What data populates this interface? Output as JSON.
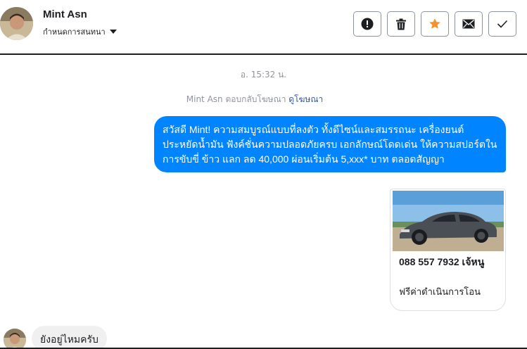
{
  "header": {
    "contact_name": "Mint Asn",
    "conversation_settings_label": "กำหนดการสนทนา"
  },
  "actions": [
    {
      "name": "report-spam-button",
      "icon": "exclamation-icon"
    },
    {
      "name": "delete-button",
      "icon": "trash-icon"
    },
    {
      "name": "star-button",
      "icon": "star-icon"
    },
    {
      "name": "mark-unread-button",
      "icon": "envelope-icon"
    },
    {
      "name": "mark-done-button",
      "icon": "check-icon"
    }
  ],
  "thread": {
    "timestamp": "อ. 15:32 น.",
    "reply_note_text": "Mint Asn ตอบกลับโฆษณา",
    "reply_note_link": "ดูโฆษณา",
    "outgoing_message": "สวัสดี Mint! ความสมบูรณ์แบบที่ลงตัว ทั้งดีไซน์และสมรรถนะ เครื่องยนต์ประหยัดน้ำมัน ฟังค์ชั่นความปลอดภัยครบ เอกลักษณ์โดดเด่น ให้ความสปอร์ตในการขับขี่ ข้าว แลก ลด 40,000 ผ่อนเริ่มต้น 5,xxx* บาท ตลอดสัญญา",
    "card": {
      "phone_line": "088 557 7932 เจ้หนู",
      "subtitle": "ฟรีค่าดำเนินการโอน"
    },
    "incoming_message": "ยังอยู่ไหมครับ"
  },
  "colors": {
    "messenger_blue": "#0084ff",
    "star_orange": "#f5922f",
    "incoming_bubble": "#f1f0f0"
  }
}
